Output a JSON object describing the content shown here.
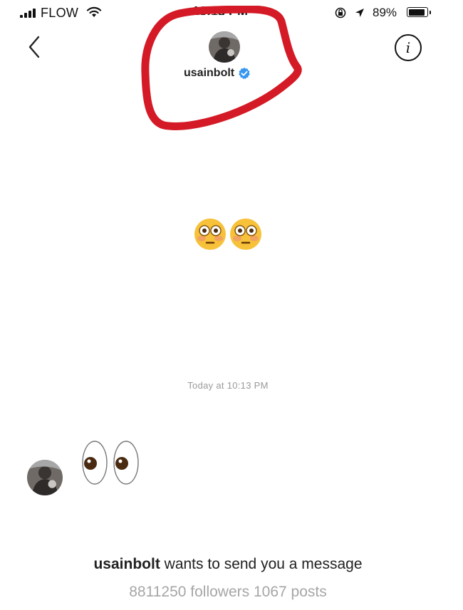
{
  "status_bar": {
    "carrier": "FLOW",
    "time": "10:13 PM",
    "battery_percent": "89%",
    "battery_level": 0.89,
    "signal_icon": "signal-bars-icon",
    "wifi_icon": "wifi-icon",
    "orientation_lock_icon": "orientation-lock-icon",
    "location_icon": "location-arrow-icon"
  },
  "header": {
    "username": "usainbolt",
    "verified": true,
    "back_icon": "chevron-left-icon",
    "info_label": "i"
  },
  "messages": {
    "first_emoji": "😳😳",
    "timestamp": "Today at 10:13 PM",
    "reply_emoji": "👀"
  },
  "request": {
    "username": "usainbolt",
    "text": " wants to send you a message",
    "stats": "8811250 followers 1067 posts"
  },
  "colors": {
    "annotation_circle": "#d41a26",
    "verified_badge": "#3897f0",
    "muted_text": "#a6a6a6"
  }
}
